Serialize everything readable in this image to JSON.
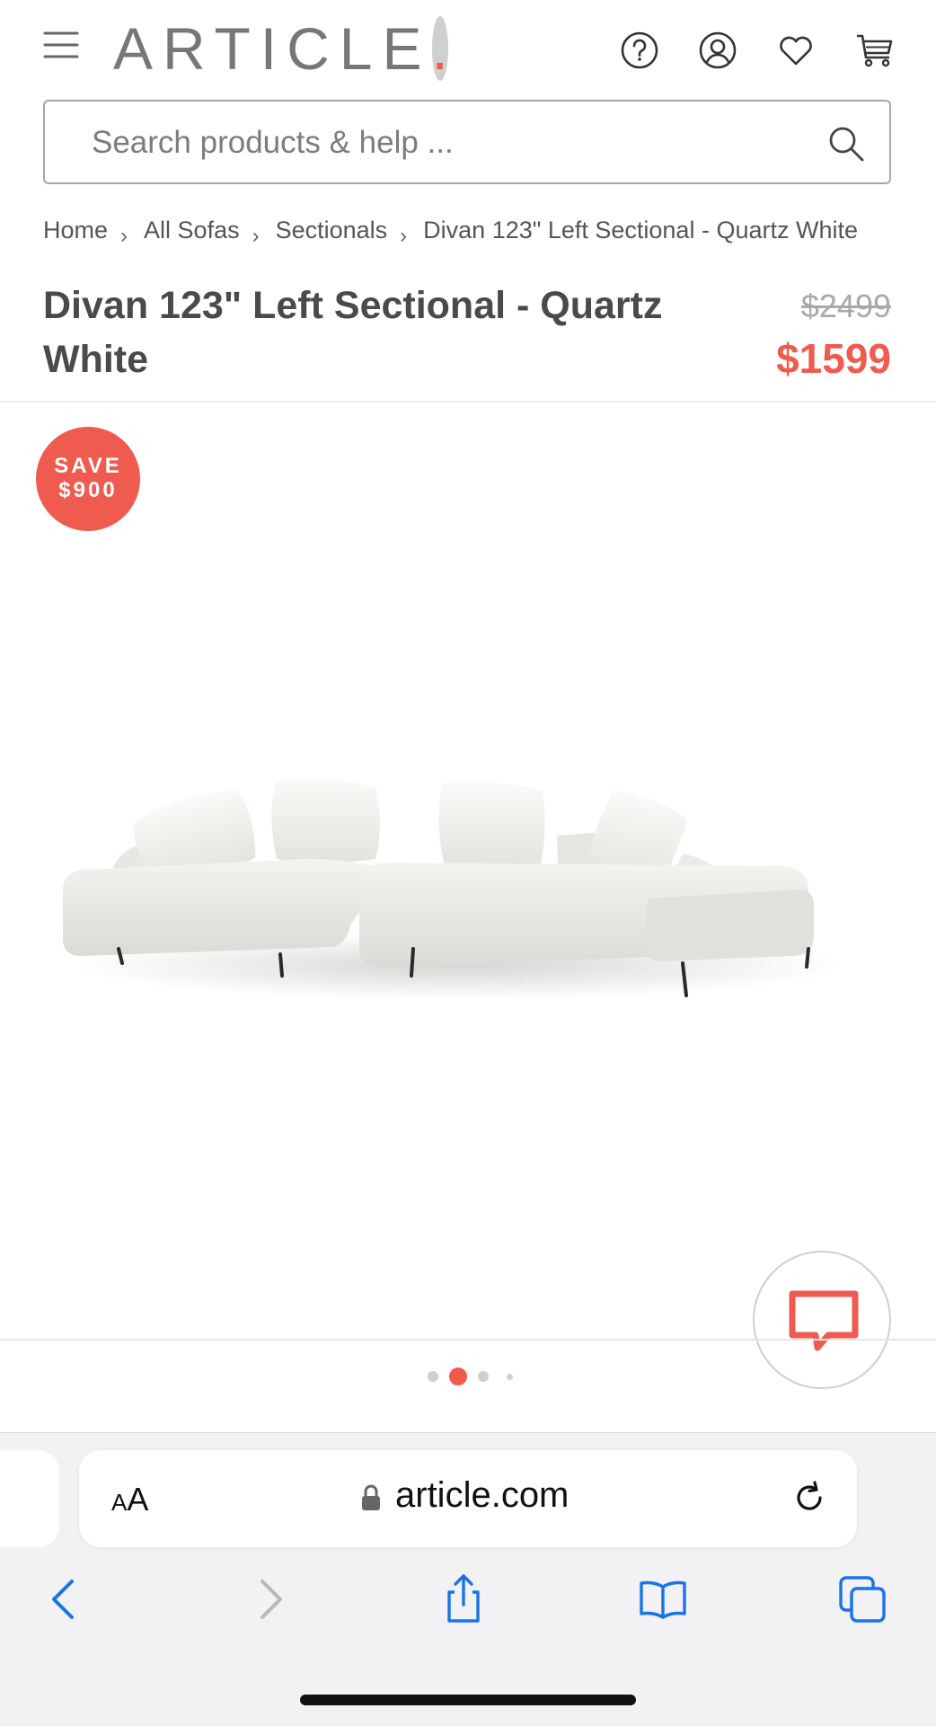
{
  "header": {
    "logo": "ARTICLE",
    "logo_dot": ".",
    "icons": [
      "menu-icon",
      "help-icon",
      "account-icon",
      "heart-icon",
      "cart-icon"
    ]
  },
  "search": {
    "placeholder": "Search products & help ..."
  },
  "breadcrumbs": [
    "Home",
    "All Sofas",
    "Sectionals",
    "Divan 123\" Left Sectional - Quartz White"
  ],
  "product": {
    "title": "Divan 123\" Left Sectional - Quartz White",
    "price_original": "$2499",
    "price_sale": "$1599",
    "badge_line1": "SAVE",
    "badge_line2": "$900",
    "gallery": {
      "total_images": 4,
      "active_index": 1
    }
  },
  "colors": {
    "accent": "#ef5b4f",
    "text": "#4a4a4a",
    "muted": "#a9a9a9"
  },
  "browser": {
    "text_size_label_big": "A",
    "text_size_label_small": "A",
    "url": "article.com",
    "toolbar_icons": [
      "back-icon",
      "forward-icon",
      "share-icon",
      "bookmarks-icon",
      "tabs-icon"
    ]
  }
}
